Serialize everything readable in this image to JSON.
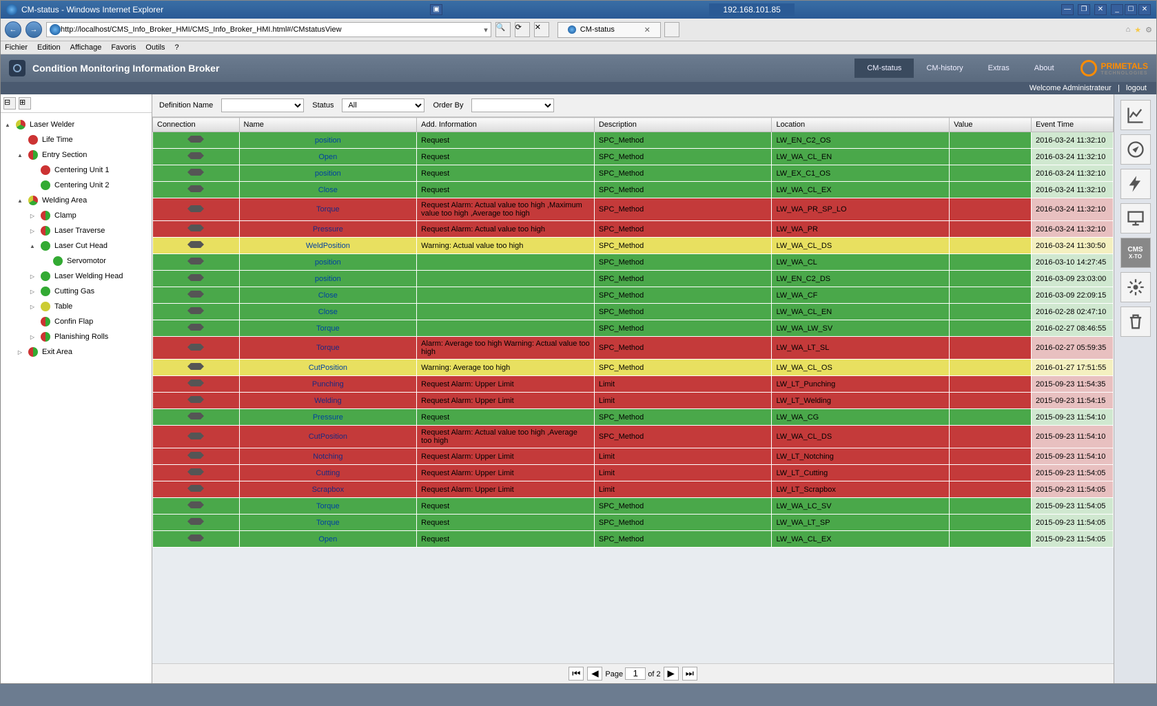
{
  "window": {
    "title": "CM-status - Windows Internet Explorer",
    "ip": "192.168.101.85"
  },
  "url": "http://localhost/CMS_Info_Broker_HMI/CMS_Info_Broker_HMI.html#/CMstatusView",
  "browser_tab": {
    "label": "CM-status"
  },
  "ie_menu": [
    "Fichier",
    "Edition",
    "Affichage",
    "Favoris",
    "Outils",
    "?"
  ],
  "app": {
    "title": "Condition Monitoring Information Broker",
    "nav": [
      {
        "label": "CM-status",
        "active": true
      },
      {
        "label": "CM-history",
        "active": false
      },
      {
        "label": "Extras",
        "active": false
      },
      {
        "label": "About",
        "active": false
      }
    ],
    "brand": "PRIMETALS",
    "brand_sub": "TECHNOLOGIES",
    "welcome": "Welcome Administrateur",
    "logout": "logout"
  },
  "tree": [
    {
      "label": "Laser Welder",
      "icon": "pie-rg",
      "indent": 0,
      "expand": "▲"
    },
    {
      "label": "Life Time",
      "icon": "dot-red",
      "indent": 1,
      "expand": ""
    },
    {
      "label": "Entry Section",
      "icon": "half-rg",
      "indent": 1,
      "expand": "▲"
    },
    {
      "label": "Centering Unit 1",
      "icon": "dot-red",
      "indent": 2,
      "expand": ""
    },
    {
      "label": "Centering Unit 2",
      "icon": "dot-green",
      "indent": 2,
      "expand": ""
    },
    {
      "label": "Welding Area",
      "icon": "pie-rg",
      "indent": 1,
      "expand": "▲"
    },
    {
      "label": "Clamp",
      "icon": "half-rg",
      "indent": 2,
      "expand": "▷"
    },
    {
      "label": "Laser Traverse",
      "icon": "half-rg",
      "indent": 2,
      "expand": "▷"
    },
    {
      "label": "Laser Cut Head",
      "icon": "dot-green",
      "indent": 2,
      "expand": "▲"
    },
    {
      "label": "Servomotor",
      "icon": "dot-green",
      "indent": 3,
      "expand": ""
    },
    {
      "label": "Laser Welding Head",
      "icon": "dot-green",
      "indent": 2,
      "expand": "▷"
    },
    {
      "label": "Cutting Gas",
      "icon": "dot-green",
      "indent": 2,
      "expand": "▷"
    },
    {
      "label": "Table",
      "icon": "dot-yellow",
      "indent": 2,
      "expand": "▷"
    },
    {
      "label": "Confin Flap",
      "icon": "half-rg",
      "indent": 2,
      "expand": ""
    },
    {
      "label": "Planishing Rolls",
      "icon": "half-rg",
      "indent": 2,
      "expand": "▷"
    },
    {
      "label": "Exit Area",
      "icon": "half-rg",
      "indent": 1,
      "expand": "▷"
    }
  ],
  "filters": {
    "definition_label": "Definition Name",
    "status_label": "Status",
    "status_value": "All",
    "orderby_label": "Order By"
  },
  "columns": [
    "Connection",
    "Name",
    "Add. Information",
    "Description",
    "Location",
    "Value",
    "Event Time"
  ],
  "rows": [
    {
      "status": "green",
      "name": "position",
      "info": "Request",
      "desc": "SPC_Method",
      "loc": "LW_EN_C2_OS",
      "val": "",
      "time": "2016-03-24 11:32:10"
    },
    {
      "status": "green",
      "name": "Open",
      "info": "Request",
      "desc": "SPC_Method",
      "loc": "LW_WA_CL_EN",
      "val": "",
      "time": "2016-03-24 11:32:10"
    },
    {
      "status": "green",
      "name": "position",
      "info": "Request",
      "desc": "SPC_Method",
      "loc": "LW_EX_C1_OS",
      "val": "",
      "time": "2016-03-24 11:32:10"
    },
    {
      "status": "green",
      "name": "Close",
      "info": "Request",
      "desc": "SPC_Method",
      "loc": "LW_WA_CL_EX",
      "val": "",
      "time": "2016-03-24 11:32:10"
    },
    {
      "status": "red",
      "name": "Torque",
      "info": "Request Alarm: Actual value too high ,Maximum value too high ,Average too high",
      "desc": "SPC_Method",
      "loc": "LW_WA_PR_SP_LO",
      "val": "",
      "time": "2016-03-24 11:32:10"
    },
    {
      "status": "red",
      "name": "Pressure",
      "info": "Request Alarm: Actual value too high",
      "desc": "SPC_Method",
      "loc": "LW_WA_PR",
      "val": "",
      "time": "2016-03-24 11:32:10"
    },
    {
      "status": "yellow",
      "name": "WeldPosition",
      "info": "Warning: Actual value too high",
      "desc": "SPC_Method",
      "loc": "LW_WA_CL_DS",
      "val": "",
      "time": "2016-03-24 11:30:50"
    },
    {
      "status": "green",
      "name": "position",
      "info": "",
      "desc": "SPC_Method",
      "loc": "LW_WA_CL",
      "val": "",
      "time": "2016-03-10 14:27:45"
    },
    {
      "status": "green",
      "name": "position",
      "info": "",
      "desc": "SPC_Method",
      "loc": "LW_EN_C2_DS",
      "val": "",
      "time": "2016-03-09 23:03:00"
    },
    {
      "status": "green",
      "name": "Close",
      "info": "",
      "desc": "SPC_Method",
      "loc": "LW_WA_CF",
      "val": "",
      "time": "2016-03-09 22:09:15"
    },
    {
      "status": "green",
      "name": "Close",
      "info": "",
      "desc": "SPC_Method",
      "loc": "LW_WA_CL_EN",
      "val": "",
      "time": "2016-02-28 02:47:10"
    },
    {
      "status": "green",
      "name": "Torque",
      "info": "",
      "desc": "SPC_Method",
      "loc": "LW_WA_LW_SV",
      "val": "",
      "time": "2016-02-27 08:46:55"
    },
    {
      "status": "red",
      "name": "Torque",
      "info": "Alarm: Average too high  Warning: Actual value too high",
      "desc": "SPC_Method",
      "loc": "LW_WA_LT_SL",
      "val": "",
      "time": "2016-02-27 05:59:35"
    },
    {
      "status": "yellow",
      "name": "CutPosition",
      "info": "Warning: Average too high",
      "desc": "SPC_Method",
      "loc": "LW_WA_CL_OS",
      "val": "",
      "time": "2016-01-27 17:51:55"
    },
    {
      "status": "red",
      "name": "Punching",
      "info": "Request Alarm: Upper Limit",
      "desc": "Limit",
      "loc": "LW_LT_Punching",
      "val": "",
      "time": "2015-09-23 11:54:35"
    },
    {
      "status": "red",
      "name": "Welding",
      "info": "Request Alarm: Upper Limit",
      "desc": "Limit",
      "loc": "LW_LT_Welding",
      "val": "",
      "time": "2015-09-23 11:54:15"
    },
    {
      "status": "green",
      "name": "Pressure",
      "info": "Request",
      "desc": "SPC_Method",
      "loc": "LW_WA_CG",
      "val": "",
      "time": "2015-09-23 11:54:10"
    },
    {
      "status": "red",
      "name": "CutPosition",
      "info": "Request Alarm: Actual value too high ,Average too high",
      "desc": "SPC_Method",
      "loc": "LW_WA_CL_DS",
      "val": "",
      "time": "2015-09-23 11:54:10"
    },
    {
      "status": "red",
      "name": "Notching",
      "info": "Request Alarm: Upper Limit",
      "desc": "Limit",
      "loc": "LW_LT_Notching",
      "val": "",
      "time": "2015-09-23 11:54:10"
    },
    {
      "status": "red",
      "name": "Cutting",
      "info": "Request Alarm: Upper Limit",
      "desc": "Limit",
      "loc": "LW_LT_Cutting",
      "val": "",
      "time": "2015-09-23 11:54:05"
    },
    {
      "status": "red",
      "name": "Scrapbox",
      "info": "Request Alarm: Upper Limit",
      "desc": "Limit",
      "loc": "LW_LT_Scrapbox",
      "val": "",
      "time": "2015-09-23 11:54:05"
    },
    {
      "status": "green",
      "name": "Torque",
      "info": "Request",
      "desc": "SPC_Method",
      "loc": "LW_WA_LC_SV",
      "val": "",
      "time": "2015-09-23 11:54:05"
    },
    {
      "status": "green",
      "name": "Torque",
      "info": "Request",
      "desc": "SPC_Method",
      "loc": "LW_WA_LT_SP",
      "val": "",
      "time": "2015-09-23 11:54:05"
    },
    {
      "status": "green",
      "name": "Open",
      "info": "Request",
      "desc": "SPC_Method",
      "loc": "LW_WA_CL_EX",
      "val": "",
      "time": "2015-09-23 11:54:05"
    }
  ],
  "pager": {
    "page_label": "Page",
    "page": "1",
    "of_label": "of 2"
  }
}
